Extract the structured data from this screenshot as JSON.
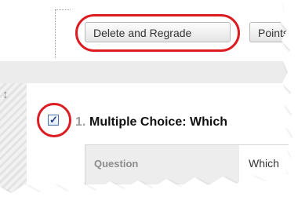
{
  "toolbar": {
    "delete_regrade_label": "Delete and Regrade",
    "points_label": "Points"
  },
  "question": {
    "move_handle": "↕",
    "checked": true,
    "checkmark": "✓",
    "number": "1.",
    "title": "Multiple Choice: Which",
    "question_label": "Question",
    "question_value": "Which"
  },
  "colors": {
    "highlight": "#dd1c22",
    "checkbox_border": "#4a6fa8",
    "checkmark": "#1d3f8c",
    "divider": "#ececec"
  }
}
